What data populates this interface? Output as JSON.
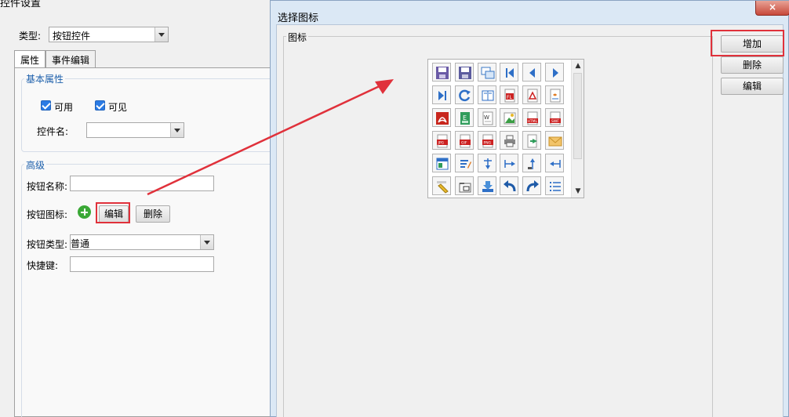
{
  "settings": {
    "window_title": "控件设置",
    "type_label": "类型:",
    "type_value": "按钮控件",
    "tabs": [
      {
        "label": "属性",
        "active": true
      },
      {
        "label": "事件编辑",
        "active": false
      }
    ],
    "basic_group_title": "基本属性",
    "enabled_label": "可用",
    "visible_label": "可见",
    "control_name_label": "控件名:",
    "control_name_value": "",
    "advanced_group_title": "高级",
    "button_name_label": "按钮名称:",
    "button_name_value": "",
    "button_icon_label": "按钮图标:",
    "edit_button": "编辑",
    "delete_button": "删除",
    "button_type_label": "按钮类型:",
    "button_type_value": "普通",
    "shortcut_label": "快捷键:",
    "shortcut_value": ""
  },
  "dialog": {
    "title": "选择图标",
    "close_label": "×",
    "fieldset_label": "图标",
    "buttons": {
      "add": "增加",
      "delete": "删除",
      "edit": "编辑"
    },
    "icons": [
      [
        "save-icon",
        "save-as-icon",
        "copy-window-icon",
        "first-page-icon",
        "prev-page-icon",
        "next-page-icon"
      ],
      [
        "last-page-icon",
        "refresh-icon",
        "book-icon",
        "flash-file-icon",
        "pdf-file-icon",
        "java-file-icon"
      ],
      [
        "acrobat-icon",
        "excel-file-icon",
        "word-file-icon",
        "image-file-icon",
        "html-file-icon",
        "swf-file-icon"
      ],
      [
        "jpg-file-icon",
        "gif-file-icon",
        "png-file-icon",
        "print-icon",
        "export-icon",
        "mail-icon"
      ],
      [
        "layout-icon",
        "edit-list-icon",
        "tree-down-icon",
        "tree-right-icon",
        "tree-up-icon",
        "tree-left-icon"
      ],
      [
        "pencil-icon",
        "folder-add-icon",
        "download-icon",
        "undo-icon",
        "redo-icon",
        "list-icon"
      ]
    ]
  },
  "colors": {
    "highlight": "#e0313b",
    "group_title": "#1c5fab",
    "dialog_frame": "#dbe8f5"
  }
}
